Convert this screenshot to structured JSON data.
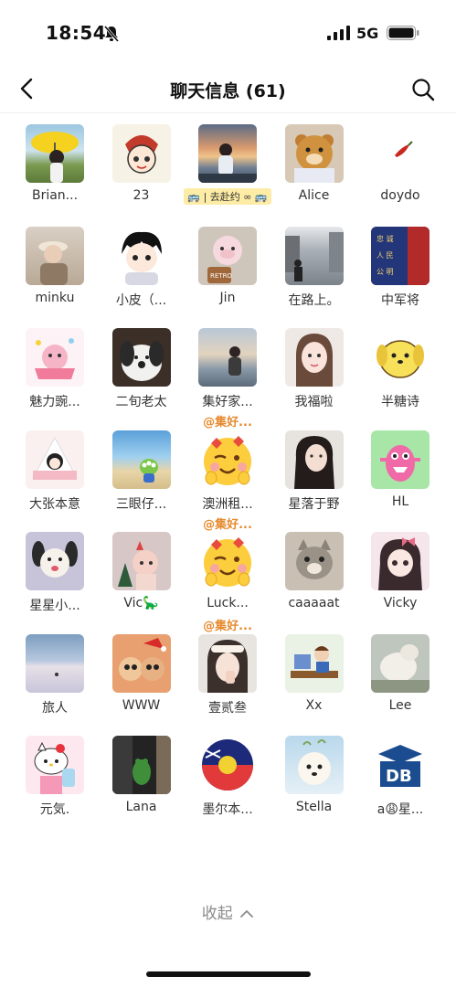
{
  "status": {
    "time": "18:54",
    "network": "5G",
    "icons": [
      "bell-muted-icon",
      "signal-icon",
      "battery-icon"
    ]
  },
  "nav": {
    "title": "聊天信息 (61)",
    "back_icon": "chevron-left-icon",
    "search_icon": "search-icon"
  },
  "members": [
    {
      "name": "Brian...",
      "avatar": "yellow-umbrella-girl"
    },
    {
      "name": "23",
      "avatar": "anime-boy-sketch"
    },
    {
      "name": "去赴约",
      "avatar": "girl-sunset",
      "tag": "🚌 | 去赴约 ∞ 🚌"
    },
    {
      "name": "Alice",
      "avatar": "teddy-bear"
    },
    {
      "name": "doydo",
      "avatar": "red-chili"
    },
    {
      "name": "minku",
      "avatar": "girl-hat"
    },
    {
      "name": "小皮（...",
      "avatar": "anime-boy-hoodie"
    },
    {
      "name": "Jin",
      "avatar": "plush-toy-pink"
    },
    {
      "name": "在路上。",
      "avatar": "street-walk"
    },
    {
      "name": "中军将",
      "avatar": "banner-blue-red"
    },
    {
      "name": "魅力豌...",
      "avatar": "cute-sticker"
    },
    {
      "name": "二旬老太",
      "avatar": "dog-plush"
    },
    {
      "name": "集好家...",
      "avatar": "girl-seaside",
      "sub": "@集好..."
    },
    {
      "name": "我福啦",
      "avatar": "girl-peace"
    },
    {
      "name": "半糖诗",
      "avatar": "yellow-dog"
    },
    {
      "name": "大张本意",
      "avatar": "girl-onigiri"
    },
    {
      "name": "三眼仔...",
      "avatar": "alien-beach"
    },
    {
      "name": "澳洲租...",
      "avatar": "wink-emoji",
      "sub": "@集好..."
    },
    {
      "name": "星落于野",
      "avatar": "girl-selfie"
    },
    {
      "name": "HL",
      "avatar": "pink-monster"
    },
    {
      "name": "星星小...",
      "avatar": "puppy-pink"
    },
    {
      "name": "Vic🦕",
      "avatar": "christmas-cat"
    },
    {
      "name": "Luck...",
      "avatar": "wink-emoji",
      "sub": "@集好..."
    },
    {
      "name": "caaaaat",
      "avatar": "cat-grey"
    },
    {
      "name": "Vicky",
      "avatar": "anime-girl-bow"
    },
    {
      "name": "旅人",
      "avatar": "salt-flat"
    },
    {
      "name": "WWW",
      "avatar": "cat-duo"
    },
    {
      "name": "壹贰叁",
      "avatar": "girl-headband"
    },
    {
      "name": "Xx",
      "avatar": "cartoon-desk"
    },
    {
      "name": "Lee",
      "avatar": "cream-dog"
    },
    {
      "name": "元気.",
      "avatar": "hello-kitty"
    },
    {
      "name": "Lana",
      "avatar": "frog-toy"
    },
    {
      "name": "墨尔本...",
      "avatar": "flag-ball"
    },
    {
      "name": "Stella",
      "avatar": "white-puppy"
    },
    {
      "name": "a😩星...",
      "avatar": "db-logo"
    }
  ],
  "collapse": {
    "label": "收起",
    "icon": "chevron-up-icon"
  },
  "colors": {
    "accent": "#e68a2e",
    "text": "#333333",
    "muted": "#8a8a8a"
  }
}
